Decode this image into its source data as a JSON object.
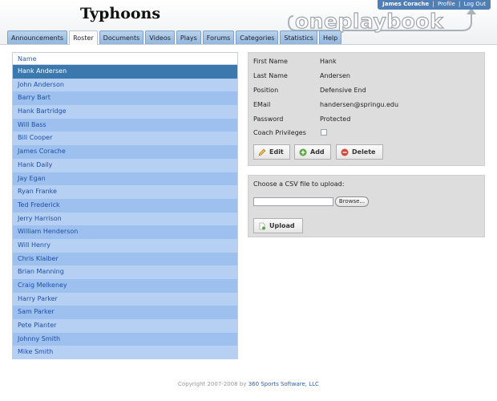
{
  "header": {
    "team_title": "Typhoons",
    "brand": "oneplaybook",
    "user_name": "James Corache",
    "profile_link": "Profile",
    "logout_link": "Log Out"
  },
  "tabs": [
    {
      "label": "Announcements",
      "active": false
    },
    {
      "label": "Roster",
      "active": true
    },
    {
      "label": "Documents",
      "active": false
    },
    {
      "label": "Videos",
      "active": false
    },
    {
      "label": "Plays",
      "active": false
    },
    {
      "label": "Forums",
      "active": false
    },
    {
      "label": "Categories",
      "active": false
    },
    {
      "label": "Statistics",
      "active": false
    },
    {
      "label": "Help",
      "active": false
    }
  ],
  "roster": {
    "column_header": "Name",
    "selected_index": 0,
    "names": [
      "Hank Andersen",
      "John Anderson",
      "Barry Bart",
      "Hank Bartridge",
      "Will Bass",
      "Bill Cooper",
      "James Corache",
      "Hank Daily",
      "Jay Egan",
      "Ryan Franke",
      "Ted Frederick",
      "Jerry Harrison",
      "William Henderson",
      "Will Henry",
      "Chris Klaiber",
      "Brian Manning",
      "Craig Melkeney",
      "Harry Parker",
      "Sam Parker",
      "Pete Planter",
      "Johnny Smith",
      "Mike Smith"
    ]
  },
  "detail": {
    "first_name_label": "First Name",
    "first_name": "Hank",
    "last_name_label": "Last Name",
    "last_name": "Andersen",
    "position_label": "Position",
    "position": "Defensive End",
    "email_label": "EMail",
    "email": "handersen@springu.edu",
    "password_label": "Password",
    "password": "Protected",
    "coach_label": "Coach Privileges",
    "coach_privileges": false,
    "edit_label": "Edit",
    "add_label": "Add",
    "delete_label": "Delete"
  },
  "upload": {
    "prompt": "Choose a CSV file to upload:",
    "file_value": "",
    "browse_label": "Browse...",
    "upload_label": "Upload"
  },
  "footer": {
    "copyright": "Copyright 2007-2008 by",
    "company": "360 Sports Software, LLC"
  },
  "colors": {
    "selected_row": "#3b78ad",
    "row_dark": "#9ec0ef",
    "row_light": "#b6d0f4",
    "link": "#1b4fa8"
  }
}
